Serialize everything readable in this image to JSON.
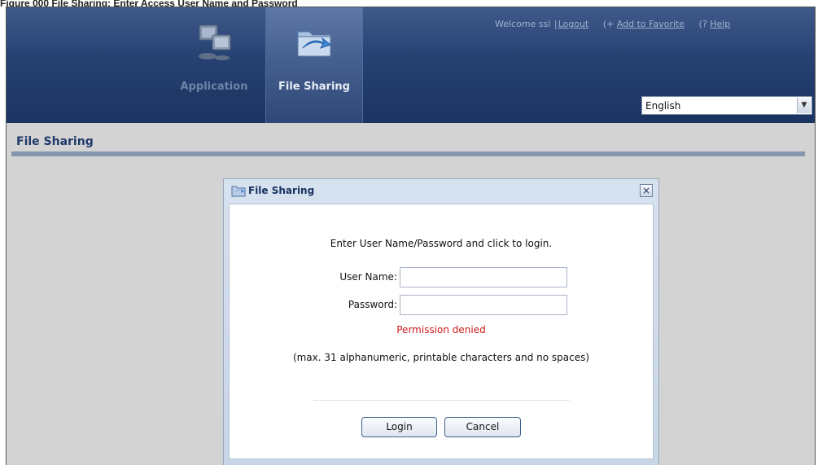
{
  "caption": "Figure 000 File Sharing: Enter Access User Name and Password",
  "header": {
    "welcome_prefix": "Welcome ssl",
    "separator": "|",
    "logout": "Logout",
    "favorite_glyph": "(+",
    "add_to_favorite": "Add to Favorite",
    "help_glyph": "(?",
    "help": "Help"
  },
  "nav": {
    "tabs": [
      {
        "label": "Application",
        "icon": "application-icon",
        "active": false
      },
      {
        "label": "File Sharing",
        "icon": "file-sharing-icon",
        "active": true
      }
    ]
  },
  "language": {
    "selected": "English"
  },
  "page": {
    "title": "File Sharing"
  },
  "dialog": {
    "title": "File Sharing",
    "close_glyph": "×",
    "instructions": "Enter User Name/Password and click to login.",
    "user_label": "User Name:",
    "password_label": "Password:",
    "user_value": "",
    "password_value": "",
    "error": "Permission denied",
    "hint": "(max. 31 alphanumeric, printable characters and no spaces)",
    "login_label": "Login",
    "cancel_label": "Cancel"
  },
  "colors": {
    "header_bg": "#243f6e",
    "title_text": "#203a6b",
    "error": "#d11a1a",
    "dialog_frame": "#c8d5e6"
  }
}
